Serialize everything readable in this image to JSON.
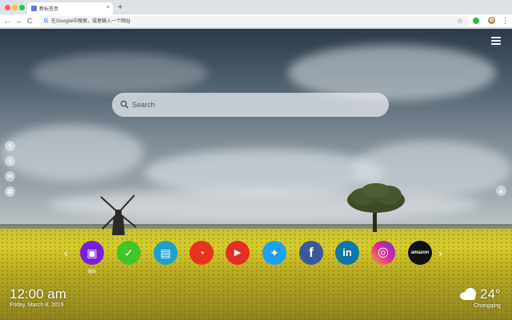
{
  "browser": {
    "tab_title": "新标签页",
    "tab_close": "×",
    "new_tab": "+",
    "back": "←",
    "forward": "→",
    "reload": "C",
    "omnibox_text": "在Google中搜索，或者输入一个网址",
    "google_icon": "G",
    "bookmark_star": "☆",
    "menu": "⋮"
  },
  "page": {
    "search": {
      "placeholder": "Search"
    },
    "social_rail": [
      "f",
      "t",
      "✉",
      "⊠"
    ],
    "right_rail": "▲",
    "dock": {
      "prev_arrow": "‹",
      "next_arrow": "›",
      "apps": [
        {
          "name": "gallery",
          "color": "#7b1fd6",
          "glyph": "▣",
          "label": "图库"
        },
        {
          "name": "todo",
          "color": "#43c529",
          "glyph": "✓",
          "label": ""
        },
        {
          "name": "notes",
          "color": "#1e9fd0",
          "glyph": "▤",
          "label": ""
        },
        {
          "name": "games",
          "color": "#e8331c",
          "glyph": "◔",
          "label": ""
        },
        {
          "name": "youtube",
          "color": "#e52d27",
          "glyph": "▶",
          "label": ""
        },
        {
          "name": "twitter",
          "color": "#1da1f2",
          "glyph": "✦",
          "label": ""
        },
        {
          "name": "facebook",
          "color": "#3b5998",
          "glyph": "f",
          "label": ""
        },
        {
          "name": "linkedin",
          "color": "#0e76a8",
          "glyph": "in",
          "label": ""
        },
        {
          "name": "instagram",
          "color": "#d6249f",
          "glyph": "◎",
          "label": ""
        },
        {
          "name": "amazon",
          "color": "#111111",
          "glyph": "amazon",
          "label": ""
        }
      ]
    },
    "clock": {
      "time": "12:00 am",
      "date": "Friday, March 8, 2019"
    },
    "weather": {
      "icon": "cloud-icon",
      "temperature": "24°",
      "city": "Chongqing"
    }
  }
}
